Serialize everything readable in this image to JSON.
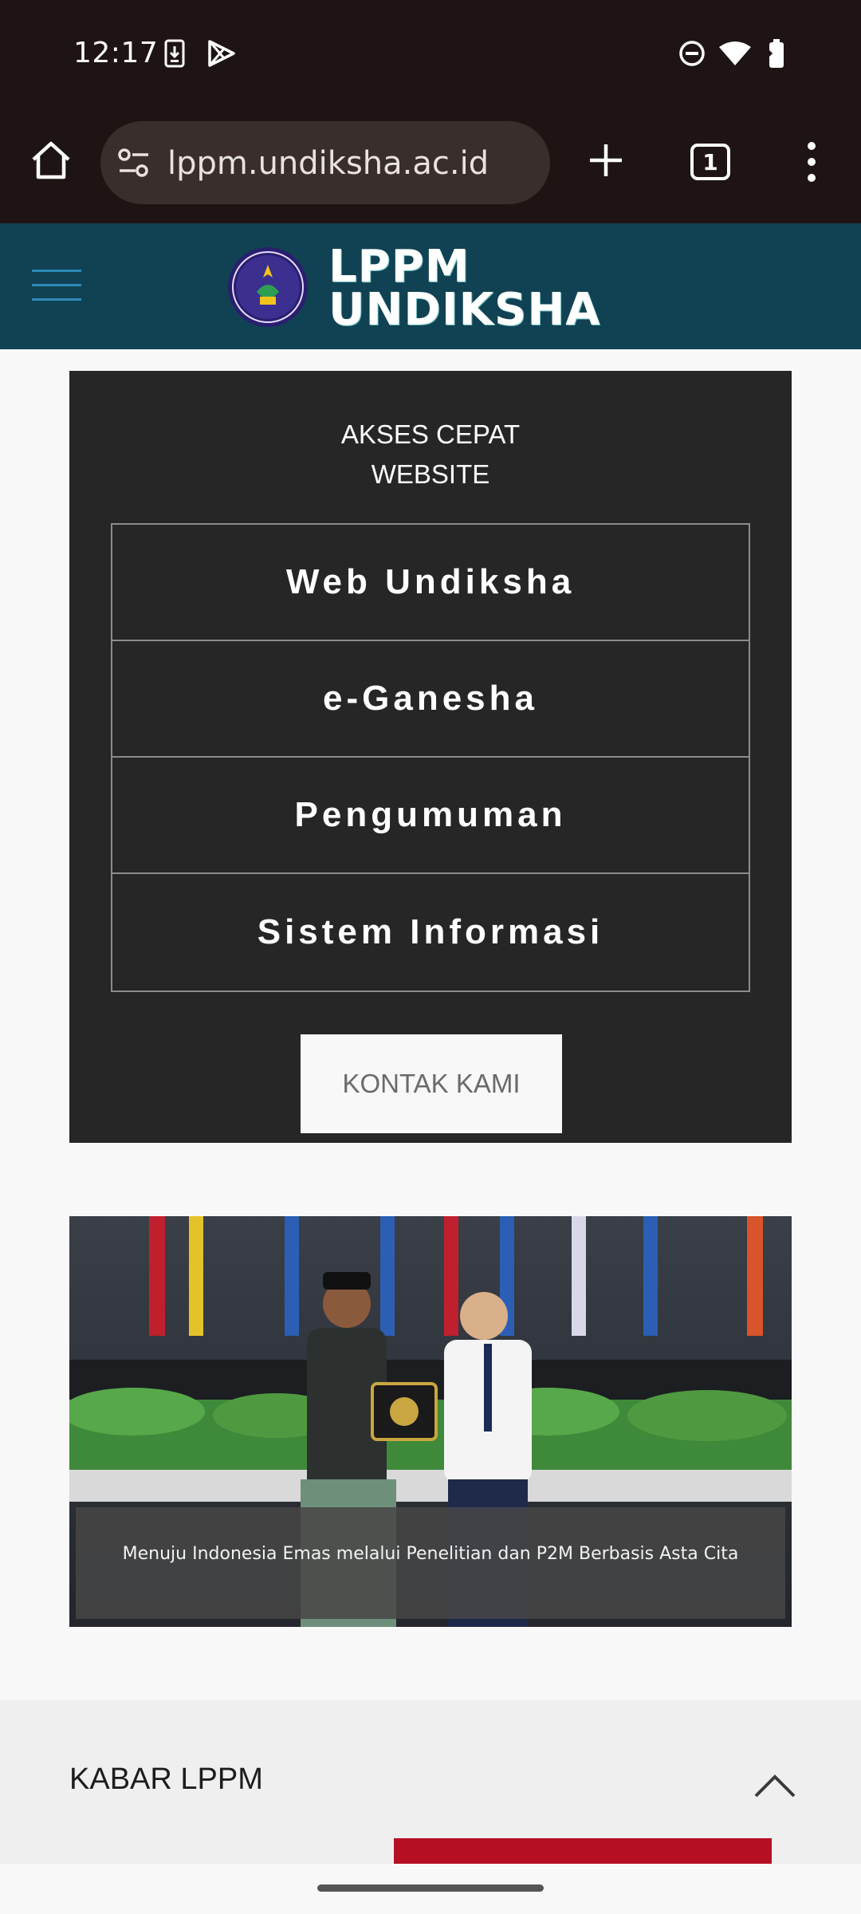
{
  "status_bar": {
    "time": "12:17",
    "left_icons": [
      "download-icon",
      "play-store-icon"
    ],
    "right_icons": [
      "dnd-icon",
      "wifi-icon",
      "battery-icon"
    ]
  },
  "browser": {
    "url": "lppm.undiksha.ac.id",
    "tab_count": "1",
    "icons": [
      "home-icon",
      "site-settings-icon",
      "new-tab-icon",
      "more-vert-icon"
    ]
  },
  "site_header": {
    "logo_line1": "LPPM",
    "logo_line2": "UNDIKSHA",
    "menu_icon": "hamburger-icon"
  },
  "quick_access": {
    "title_line1": "AKSES CEPAT",
    "title_line2": "WEBSITE",
    "links": [
      {
        "label": "Web Undiksha"
      },
      {
        "label": "e-Ganesha"
      },
      {
        "label": "Pengumuman"
      },
      {
        "label": "Sistem Informasi"
      }
    ],
    "contact_label": "KONTAK KAMI"
  },
  "slide": {
    "caption": "Menuju Indonesia Emas melalui Penelitian dan P2M Berbasis Asta Cita"
  },
  "news": {
    "title": "KABAR LPPM",
    "scroll_top_icon": "chevron-up-icon"
  },
  "colors": {
    "status_bg": "#1f1414",
    "header_bg": "#114253",
    "quick_box_bg": "#262626",
    "accent_red": "#b50f24"
  }
}
